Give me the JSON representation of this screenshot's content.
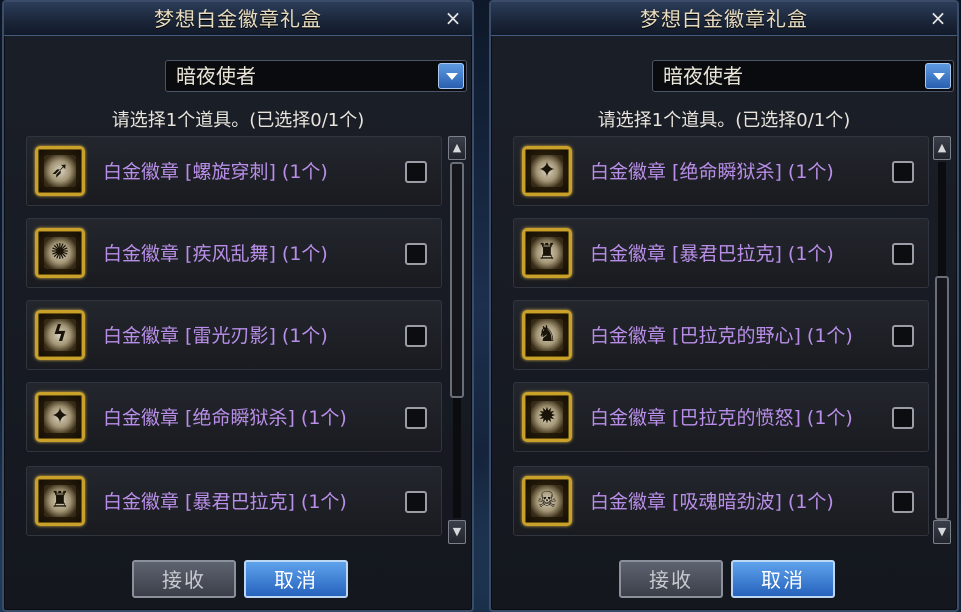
{
  "dialogs": [
    {
      "title": "梦想白金徽章礼盒",
      "close_icon": "×",
      "job_select": {
        "value": "暗夜使者"
      },
      "instruction": "请选择1个道具。(已选择0/1个)",
      "items": [
        {
          "label": "白金徽章 [螺旋穿刺] (1个)",
          "icon": "spiral-pierce-icon",
          "glyph": "➶",
          "checked": false
        },
        {
          "label": "白金徽章 [疾风乱舞] (1个)",
          "icon": "gale-dance-icon",
          "glyph": "✺",
          "checked": false
        },
        {
          "label": "白金徽章 [雷光刃影] (1个)",
          "icon": "lightning-blade-icon",
          "glyph": "ϟ",
          "checked": false
        },
        {
          "label": "白金徽章 [绝命瞬狱杀] (1个)",
          "icon": "instant-kill-icon",
          "glyph": "✦",
          "checked": false
        },
        {
          "label": "白金徽章 [暴君巴拉克] (1个)",
          "icon": "tyrant-balack-icon",
          "glyph": "♜",
          "checked": false
        }
      ],
      "scroll_up_icon": "▲",
      "scroll_down_icon": "▼",
      "accept_label": "接收",
      "cancel_label": "取消"
    },
    {
      "title": "梦想白金徽章礼盒",
      "close_icon": "×",
      "job_select": {
        "value": "暗夜使者"
      },
      "instruction": "请选择1个道具。(已选择0/1个)",
      "items": [
        {
          "label": "白金徽章 [绝命瞬狱杀] (1个)",
          "icon": "instant-kill-icon",
          "glyph": "✦",
          "checked": false
        },
        {
          "label": "白金徽章 [暴君巴拉克] (1个)",
          "icon": "tyrant-balack-icon",
          "glyph": "♜",
          "checked": false
        },
        {
          "label": "白金徽章 [巴拉克的野心] (1个)",
          "icon": "balack-ambition-icon",
          "glyph": "♞",
          "checked": false
        },
        {
          "label": "白金徽章 [巴拉克的愤怒] (1个)",
          "icon": "balack-fury-icon",
          "glyph": "✹",
          "checked": false
        },
        {
          "label": "白金徽章 [吸魂暗劲波] (1个)",
          "icon": "soul-drain-icon",
          "glyph": "☠",
          "checked": false
        }
      ],
      "scroll_up_icon": "▲",
      "scroll_down_icon": "▼",
      "accept_label": "接收",
      "cancel_label": "取消"
    }
  ],
  "colors": {
    "item_text": "#b98ee8",
    "badge_gold": "#c9a02a",
    "accept_button": "#4a4e58",
    "cancel_button": "#3f85d8"
  }
}
